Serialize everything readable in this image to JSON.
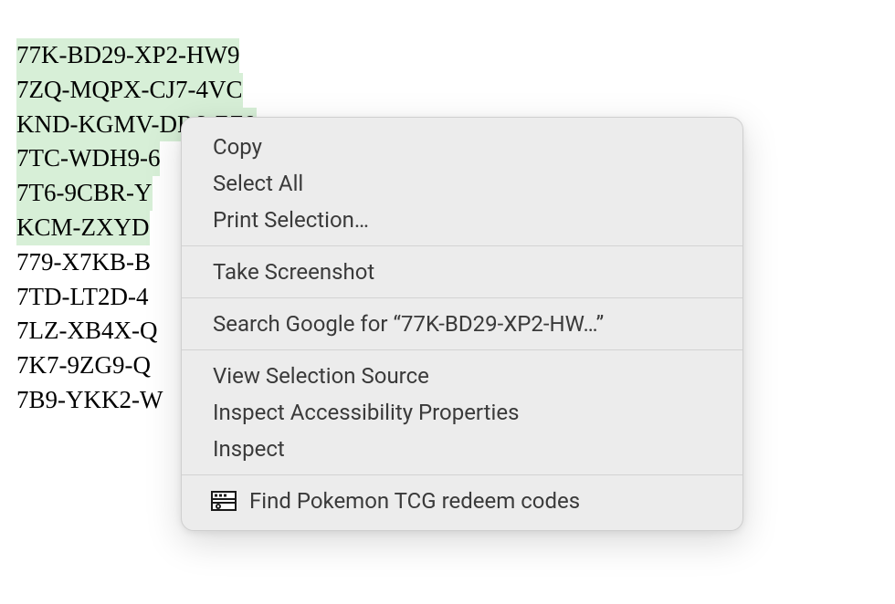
{
  "codes": {
    "highlighted": [
      "77K-BD29-XP2-HW9",
      "7ZQ-MQPX-CJ7-4VC",
      "KND-KGMV-DR6-ZZ9",
      "7TC-WDH9-6",
      "7T6-9CBR-Y",
      "KCM-ZXYD"
    ],
    "plain": [
      "779-X7KB-B",
      "7TD-LT2D-4",
      "7LZ-XB4X-Q",
      "7K7-9ZG9-Q",
      "7B9-YKK2-W"
    ]
  },
  "context_menu": {
    "group1": {
      "copy": "Copy",
      "select_all": "Select All",
      "print_selection": "Print Selection…"
    },
    "group2": {
      "take_screenshot": "Take Screenshot"
    },
    "group3": {
      "search_google": "Search Google for “77K-BD29-XP2-HW…”"
    },
    "group4": {
      "view_selection_source": "View Selection Source",
      "inspect_accessibility": "Inspect Accessibility Properties",
      "inspect": "Inspect"
    },
    "group5": {
      "find_codes": "Find Pokemon TCG redeem codes"
    }
  }
}
